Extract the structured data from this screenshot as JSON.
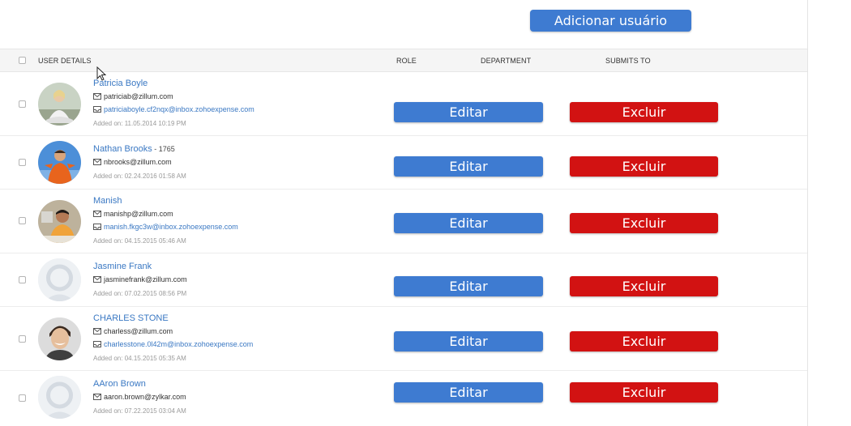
{
  "header": {
    "add_user_label": "Adicionar usuário"
  },
  "table": {
    "columns": {
      "user_details": "USER DETAILS",
      "role": "ROLE",
      "department": "DEPARTMENT",
      "submits_to": "SUBMITS TO"
    },
    "rows": [
      {
        "name": "Patricia Boyle",
        "employee_id": "",
        "email": "patriciab@zillum.com",
        "inbox": "patriciaboyle.cf2nqx@inbox.zohoexpense.com",
        "added_on": "Added on: 11.05.2014 10:19 PM",
        "avatar": "photo-woman-meditating",
        "edit_label": "Editar",
        "delete_label": "Excluir"
      },
      {
        "name": "Nathan Brooks",
        "employee_id": "- 1765",
        "email": "nbrooks@zillum.com",
        "inbox": "",
        "added_on": "Added on: 02.24.2016 01:58 AM",
        "avatar": "photo-man-orange-jacket",
        "edit_label": "Editar",
        "delete_label": "Excluir"
      },
      {
        "name": "Manish",
        "employee_id": "",
        "email": "manishp@zillum.com",
        "inbox": "manish.fkgc3w@inbox.zohoexpense.com",
        "added_on": "Added on: 04.15.2015 05:46 AM",
        "avatar": "photo-man-desk",
        "edit_label": "Editar",
        "delete_label": "Excluir"
      },
      {
        "name": "Jasmine Frank",
        "employee_id": "",
        "email": "jasminefrank@zillum.com",
        "inbox": "",
        "added_on": "Added on: 07.02.2015 08:56 PM",
        "avatar": "placeholder",
        "edit_label": "Editar",
        "delete_label": "Excluir"
      },
      {
        "name": "CHARLES STONE",
        "employee_id": "",
        "email": "charless@zillum.com",
        "inbox": "charlesstone.0l42m@inbox.zohoexpense.com",
        "added_on": "Added on: 04.15.2015 05:35 AM",
        "avatar": "photo-man-smiling",
        "edit_label": "Editar",
        "delete_label": "Excluir"
      },
      {
        "name": "AAron Brown",
        "employee_id": "",
        "email": "aaron.brown@zylkar.com",
        "inbox": "",
        "added_on": "Added on: 07.22.2015 03:04 AM",
        "avatar": "placeholder",
        "edit_label": "Editar",
        "delete_label": "Excluir"
      }
    ]
  },
  "colors": {
    "primary_button": "#3e7bd1",
    "danger_button": "#d21212",
    "link": "#3a78c3",
    "header_bg": "#f5f5f5"
  },
  "icons": {
    "email": "envelope-icon",
    "inbox": "inbox-icon",
    "cursor": "mouse-pointer-icon"
  }
}
